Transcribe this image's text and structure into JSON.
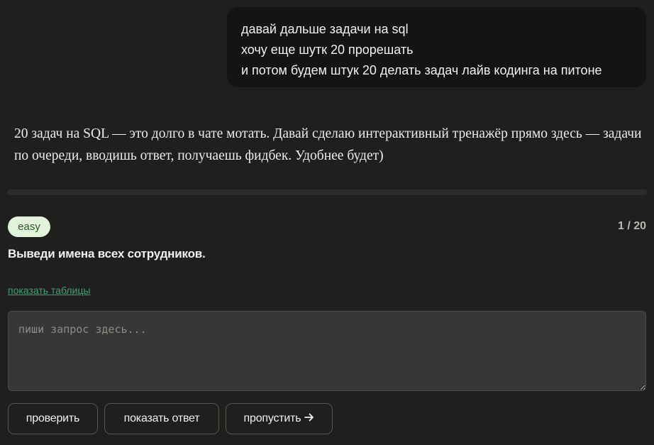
{
  "user_message": {
    "lines": [
      "давай дальше задачи на sql",
      "хочу еще шутк 20 прорешать",
      "и потом будем штук 20 делать задач лайв кодинга на питоне"
    ]
  },
  "assistant_message": {
    "text": "20 задач на SQL — это долго в чате мотать. Давай сделаю интерактивный тренажёр прямо здесь — задачи по очереди, вводишь ответ, получаешь фидбек. Удобнее будет)"
  },
  "trainer": {
    "level": "easy",
    "counter": "1 / 20",
    "task": "Выведи имена всех сотрудников.",
    "show_tables": "показать таблицы",
    "input": {
      "value": "",
      "placeholder": "пиши запрос здесь..."
    },
    "buttons": {
      "check": "проверить",
      "show_answer": "показать ответ",
      "skip": "пропустить"
    },
    "skip_icon": "arrow-right-icon",
    "colors": {
      "badge_bg": "#e2f3dc",
      "badge_text": "#2d5a22",
      "link": "#3aa27a"
    }
  }
}
